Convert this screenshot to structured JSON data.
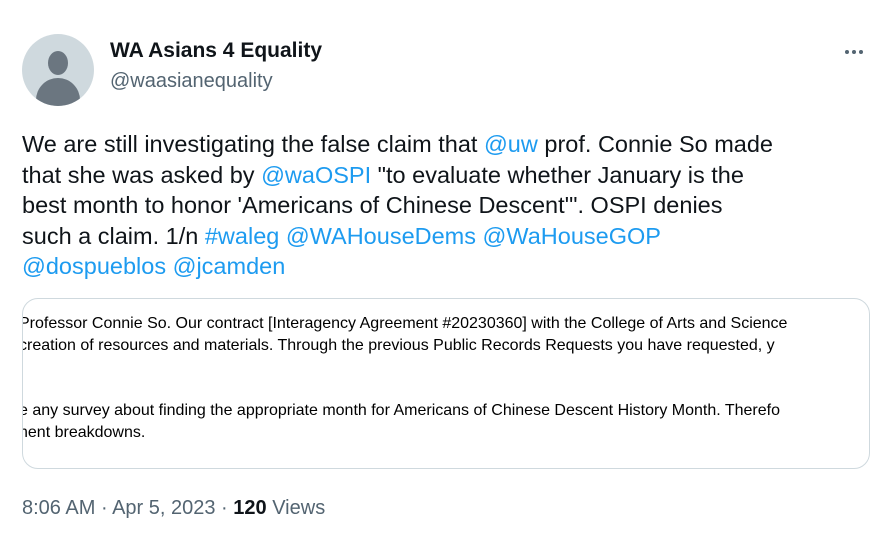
{
  "author": {
    "name": "WA Asians 4 Equality",
    "handle": "@waasianequality"
  },
  "tweet": {
    "line1": {
      "t1": "We are still investigating the false claim that ",
      "m1": "@uw",
      "t2": " prof. Connie So made"
    },
    "line2": {
      "t1": "that she was asked by ",
      "m1": "@waOSPI",
      "t2": " \"to evaluate whether January is the"
    },
    "line3": {
      "t1": "best month to honor 'Americans of Chinese Descent'\". OSPI denies"
    },
    "line4": {
      "t1": "such a claim.  1/n ",
      "h1": "#waleg",
      "m1": "@WAHouseDems",
      "m2": "@WaHouseGOP"
    },
    "line5": {
      "m1": "@dospueblos",
      "m2": "@jcamden"
    }
  },
  "document_excerpt": {
    "line1": "Professor Connie So. Our contract [Interagency Agreement #20230360] with the College of Arts and Science",
    "line2": " creation of resources and materials. Through the previous Public Records Requests you have requested, y",
    "line3": "e any survey about finding the appropriate month for Americans of Chinese Descent History Month. Therefo",
    "line4": "nent breakdowns."
  },
  "meta": {
    "time": "8:06 AM",
    "separator": " · ",
    "date": "Apr 5, 2023",
    "views_count": "120",
    "views_label": "Views"
  },
  "colors": {
    "link": "#1d9bf0",
    "text": "#0f1419",
    "secondary": "#536471",
    "border": "#cfd9de"
  },
  "icons": {
    "more": "more-horizontal-icon",
    "avatar": "default-avatar-icon"
  }
}
